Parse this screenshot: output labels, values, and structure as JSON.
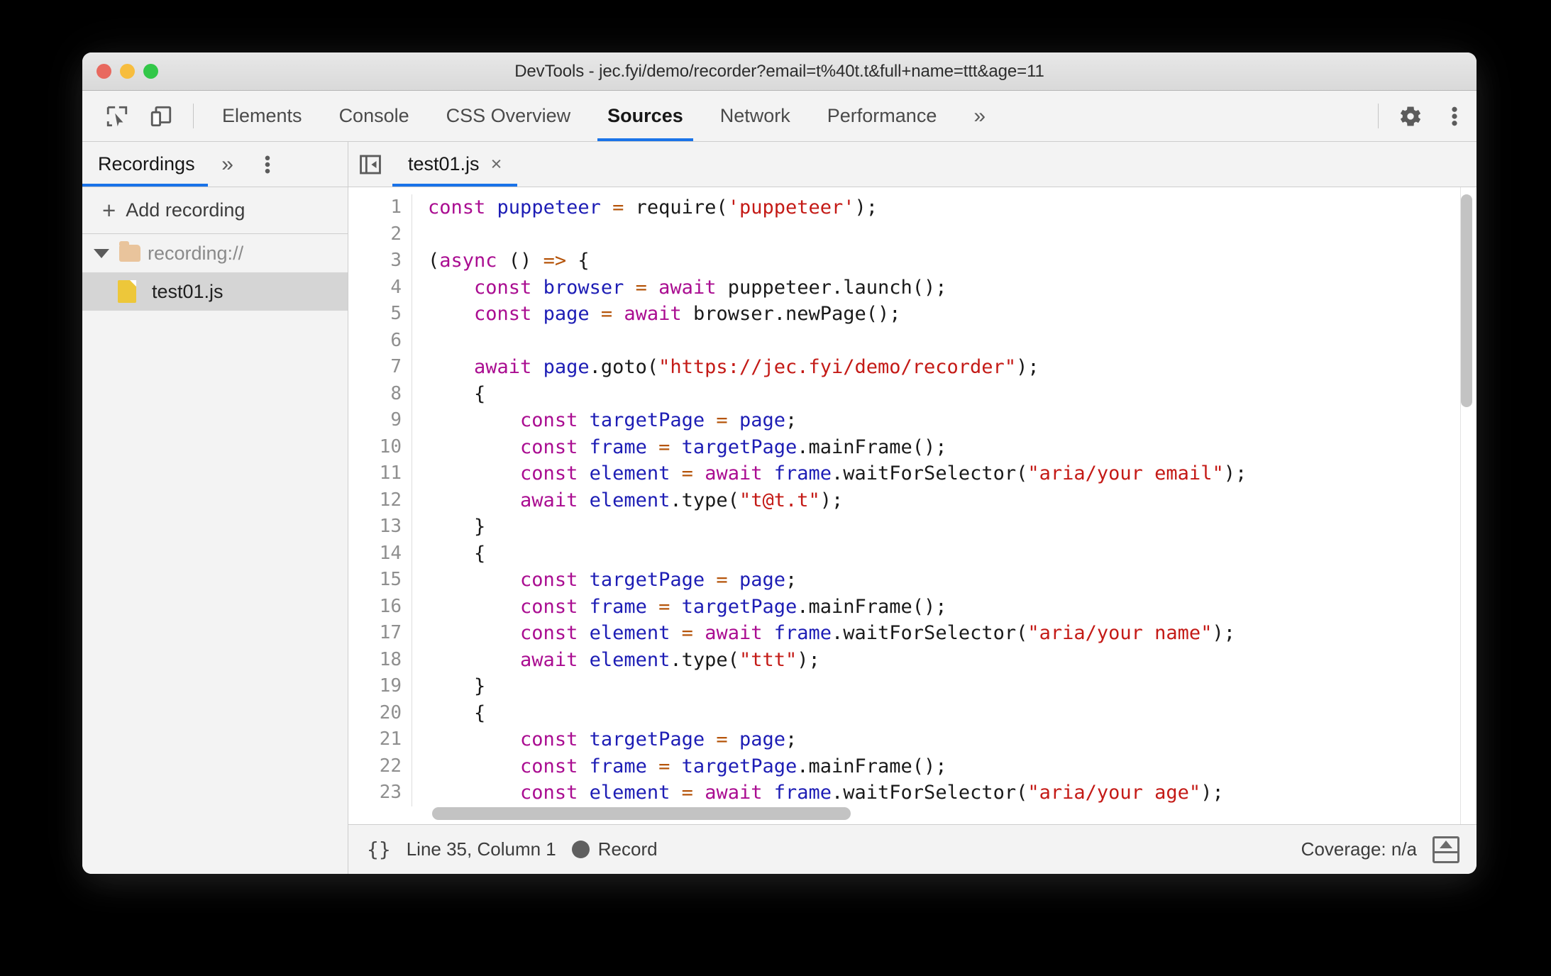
{
  "window": {
    "title": "DevTools - jec.fyi/demo/recorder?email=t%40t.t&full+name=ttt&age=11",
    "traffic_lights": [
      "close",
      "minimize",
      "zoom"
    ]
  },
  "main_tabs": {
    "icons": [
      "inspect-element-icon",
      "device-toolbar-icon"
    ],
    "items": [
      {
        "label": "Elements",
        "active": false
      },
      {
        "label": "Console",
        "active": false
      },
      {
        "label": "CSS Overview",
        "active": false
      },
      {
        "label": "Sources",
        "active": true
      },
      {
        "label": "Network",
        "active": false
      },
      {
        "label": "Performance",
        "active": false
      }
    ],
    "more_label": "»",
    "settings_icon": "gear-icon",
    "menu_icon": "more-vertical-icon",
    "active_underline_color": "#1a73e8"
  },
  "sidebar": {
    "tab_label": "Recordings",
    "more_label": "»",
    "menu_icon": "more-vertical-icon",
    "add_recording": {
      "plus": "+",
      "label": "Add recording"
    },
    "tree": {
      "folder": {
        "label": "recording://",
        "expanded": true
      },
      "file": {
        "label": "test01.js",
        "selected": true
      }
    }
  },
  "editor": {
    "collapse_icon": "collapse-sidebar-icon",
    "tab_label": "test01.js",
    "close_label": "×",
    "syntax_colors": {
      "keyword": "#aa0d91",
      "variable": "#1d1db5",
      "operator": "#b5540a",
      "string": "#c41a16",
      "plain": "#1a1a1a"
    },
    "lines": [
      {
        "n": "1",
        "tokens": [
          [
            "kw",
            "const"
          ],
          [
            "pl",
            " "
          ],
          [
            "var",
            "puppeteer"
          ],
          [
            "pl",
            " "
          ],
          [
            "op",
            "="
          ],
          [
            "pl",
            " require("
          ],
          [
            "str",
            "'puppeteer'"
          ],
          [
            "pl",
            ");"
          ]
        ]
      },
      {
        "n": "2",
        "tokens": []
      },
      {
        "n": "3",
        "tokens": [
          [
            "pl",
            "("
          ],
          [
            "kw",
            "async"
          ],
          [
            "pl",
            " () "
          ],
          [
            "op",
            "=>"
          ],
          [
            "pl",
            " {"
          ]
        ]
      },
      {
        "n": "4",
        "tokens": [
          [
            "pl",
            "    "
          ],
          [
            "kw",
            "const"
          ],
          [
            "pl",
            " "
          ],
          [
            "var",
            "browser"
          ],
          [
            "pl",
            " "
          ],
          [
            "op",
            "="
          ],
          [
            "pl",
            " "
          ],
          [
            "kw",
            "await"
          ],
          [
            "pl",
            " puppeteer.launch();"
          ]
        ]
      },
      {
        "n": "5",
        "tokens": [
          [
            "pl",
            "    "
          ],
          [
            "kw",
            "const"
          ],
          [
            "pl",
            " "
          ],
          [
            "var",
            "page"
          ],
          [
            "pl",
            " "
          ],
          [
            "op",
            "="
          ],
          [
            "pl",
            " "
          ],
          [
            "kw",
            "await"
          ],
          [
            "pl",
            " browser.newPage();"
          ]
        ]
      },
      {
        "n": "6",
        "tokens": []
      },
      {
        "n": "7",
        "tokens": [
          [
            "pl",
            "    "
          ],
          [
            "kw",
            "await"
          ],
          [
            "pl",
            " "
          ],
          [
            "var",
            "page"
          ],
          [
            "pl",
            ".goto("
          ],
          [
            "str",
            "\"https://jec.fyi/demo/recorder\""
          ],
          [
            "pl",
            ");"
          ]
        ]
      },
      {
        "n": "8",
        "tokens": [
          [
            "pl",
            "    {"
          ]
        ]
      },
      {
        "n": "9",
        "tokens": [
          [
            "pl",
            "        "
          ],
          [
            "kw",
            "const"
          ],
          [
            "pl",
            " "
          ],
          [
            "var",
            "targetPage"
          ],
          [
            "pl",
            " "
          ],
          [
            "op",
            "="
          ],
          [
            "pl",
            " "
          ],
          [
            "var",
            "page"
          ],
          [
            "pl",
            ";"
          ]
        ]
      },
      {
        "n": "10",
        "tokens": [
          [
            "pl",
            "        "
          ],
          [
            "kw",
            "const"
          ],
          [
            "pl",
            " "
          ],
          [
            "var",
            "frame"
          ],
          [
            "pl",
            " "
          ],
          [
            "op",
            "="
          ],
          [
            "pl",
            " "
          ],
          [
            "var",
            "targetPage"
          ],
          [
            "pl",
            ".mainFrame();"
          ]
        ]
      },
      {
        "n": "11",
        "tokens": [
          [
            "pl",
            "        "
          ],
          [
            "kw",
            "const"
          ],
          [
            "pl",
            " "
          ],
          [
            "var",
            "element"
          ],
          [
            "pl",
            " "
          ],
          [
            "op",
            "="
          ],
          [
            "pl",
            " "
          ],
          [
            "kw",
            "await"
          ],
          [
            "pl",
            " "
          ],
          [
            "var",
            "frame"
          ],
          [
            "pl",
            ".waitForSelector("
          ],
          [
            "str",
            "\"aria/your email\""
          ],
          [
            "pl",
            ");"
          ]
        ]
      },
      {
        "n": "12",
        "tokens": [
          [
            "pl",
            "        "
          ],
          [
            "kw",
            "await"
          ],
          [
            "pl",
            " "
          ],
          [
            "var",
            "element"
          ],
          [
            "pl",
            ".type("
          ],
          [
            "str",
            "\"t@t.t\""
          ],
          [
            "pl",
            ");"
          ]
        ]
      },
      {
        "n": "13",
        "tokens": [
          [
            "pl",
            "    }"
          ]
        ]
      },
      {
        "n": "14",
        "tokens": [
          [
            "pl",
            "    {"
          ]
        ]
      },
      {
        "n": "15",
        "tokens": [
          [
            "pl",
            "        "
          ],
          [
            "kw",
            "const"
          ],
          [
            "pl",
            " "
          ],
          [
            "var",
            "targetPage"
          ],
          [
            "pl",
            " "
          ],
          [
            "op",
            "="
          ],
          [
            "pl",
            " "
          ],
          [
            "var",
            "page"
          ],
          [
            "pl",
            ";"
          ]
        ]
      },
      {
        "n": "16",
        "tokens": [
          [
            "pl",
            "        "
          ],
          [
            "kw",
            "const"
          ],
          [
            "pl",
            " "
          ],
          [
            "var",
            "frame"
          ],
          [
            "pl",
            " "
          ],
          [
            "op",
            "="
          ],
          [
            "pl",
            " "
          ],
          [
            "var",
            "targetPage"
          ],
          [
            "pl",
            ".mainFrame();"
          ]
        ]
      },
      {
        "n": "17",
        "tokens": [
          [
            "pl",
            "        "
          ],
          [
            "kw",
            "const"
          ],
          [
            "pl",
            " "
          ],
          [
            "var",
            "element"
          ],
          [
            "pl",
            " "
          ],
          [
            "op",
            "="
          ],
          [
            "pl",
            " "
          ],
          [
            "kw",
            "await"
          ],
          [
            "pl",
            " "
          ],
          [
            "var",
            "frame"
          ],
          [
            "pl",
            ".waitForSelector("
          ],
          [
            "str",
            "\"aria/your name\""
          ],
          [
            "pl",
            ");"
          ]
        ]
      },
      {
        "n": "18",
        "tokens": [
          [
            "pl",
            "        "
          ],
          [
            "kw",
            "await"
          ],
          [
            "pl",
            " "
          ],
          [
            "var",
            "element"
          ],
          [
            "pl",
            ".type("
          ],
          [
            "str",
            "\"ttt\""
          ],
          [
            "pl",
            ");"
          ]
        ]
      },
      {
        "n": "19",
        "tokens": [
          [
            "pl",
            "    }"
          ]
        ]
      },
      {
        "n": "20",
        "tokens": [
          [
            "pl",
            "    {"
          ]
        ]
      },
      {
        "n": "21",
        "tokens": [
          [
            "pl",
            "        "
          ],
          [
            "kw",
            "const"
          ],
          [
            "pl",
            " "
          ],
          [
            "var",
            "targetPage"
          ],
          [
            "pl",
            " "
          ],
          [
            "op",
            "="
          ],
          [
            "pl",
            " "
          ],
          [
            "var",
            "page"
          ],
          [
            "pl",
            ";"
          ]
        ]
      },
      {
        "n": "22",
        "tokens": [
          [
            "pl",
            "        "
          ],
          [
            "kw",
            "const"
          ],
          [
            "pl",
            " "
          ],
          [
            "var",
            "frame"
          ],
          [
            "pl",
            " "
          ],
          [
            "op",
            "="
          ],
          [
            "pl",
            " "
          ],
          [
            "var",
            "targetPage"
          ],
          [
            "pl",
            ".mainFrame();"
          ]
        ]
      },
      {
        "n": "23",
        "tokens": [
          [
            "pl",
            "        "
          ],
          [
            "kw",
            "const"
          ],
          [
            "pl",
            " "
          ],
          [
            "var",
            "element"
          ],
          [
            "pl",
            " "
          ],
          [
            "op",
            "="
          ],
          [
            "pl",
            " "
          ],
          [
            "kw",
            "await"
          ],
          [
            "pl",
            " "
          ],
          [
            "var",
            "frame"
          ],
          [
            "pl",
            ".waitForSelector("
          ],
          [
            "str",
            "\"aria/your age\""
          ],
          [
            "pl",
            ");"
          ]
        ]
      }
    ]
  },
  "status": {
    "pretty_print": "{}",
    "cursor": "Line 35, Column 1",
    "record_label": "Record",
    "coverage": "Coverage: n/a",
    "drawer_icon": "show-drawer-icon"
  }
}
